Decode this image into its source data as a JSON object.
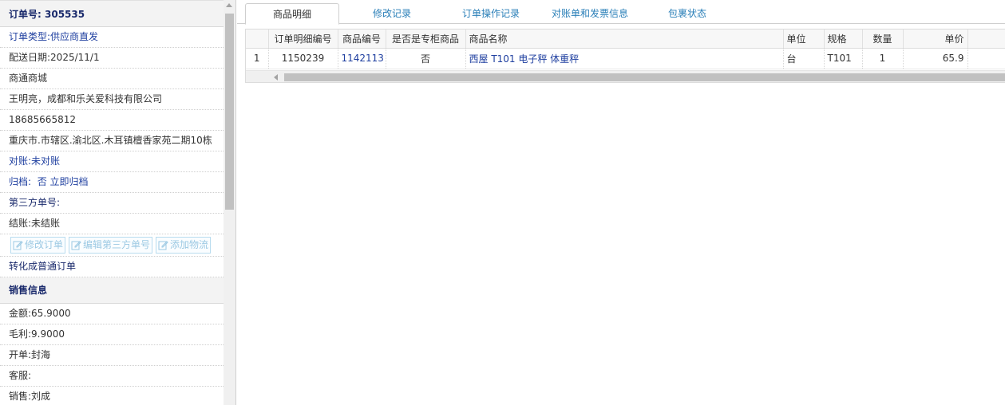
{
  "order": {
    "title_label": "订单号:",
    "title_value": "305535",
    "rows": [
      {
        "label": "订单类型:",
        "value": "供应商直发"
      },
      {
        "label": "配送日期:",
        "value": "2025/11/1"
      },
      {
        "label": "",
        "value": "商通商城"
      },
      {
        "label": "",
        "value": "王明亮，成都和乐关爱科技有限公司"
      },
      {
        "label": "",
        "value": "18685665812"
      },
      {
        "label": "",
        "value": "重庆市.市辖区.渝北区.木耳镇檀香家苑二期10栋"
      },
      {
        "label": "对账:",
        "value": "未对账"
      },
      {
        "label": "归档:",
        "value": "否 立即归档"
      },
      {
        "label": "第三方单号:",
        "value": ""
      },
      {
        "label": "结账:",
        "value": "未结账"
      }
    ],
    "buttons": {
      "edit_order": "修改订单",
      "edit_third_party": "编辑第三方单号",
      "add_logistics": "添加物流"
    },
    "convert_link": "转化成普通订单"
  },
  "sales": {
    "title": "销售信息",
    "rows": [
      {
        "label": "金额:",
        "value": "65.9000"
      },
      {
        "label": "毛利:",
        "value": "9.9000"
      },
      {
        "label": "开单:",
        "value": "封海"
      },
      {
        "label": "客服:",
        "value": ""
      },
      {
        "label": "销售:",
        "value": "刘成"
      }
    ]
  },
  "tabs": [
    "商品明细",
    "修改记录",
    "订单操作记录",
    "对账单和发票信息",
    "包裹状态"
  ],
  "grid": {
    "headers": [
      "",
      "订单明细编号",
      "商品编号",
      "是否是专柜商品",
      "商品名称",
      "单位",
      "规格",
      "数量",
      "单价"
    ],
    "rows": [
      [
        "1",
        "1150239",
        "1142113",
        "否",
        "西屋 T101 电子秤 体重秤",
        "台",
        "T101",
        "1",
        "65.9"
      ]
    ]
  },
  "colors": {
    "link": "#2040a0",
    "tab_link": "#2a7fb8",
    "section_title": "#1a2a6c",
    "disabled_button": "#9cc9e3"
  }
}
